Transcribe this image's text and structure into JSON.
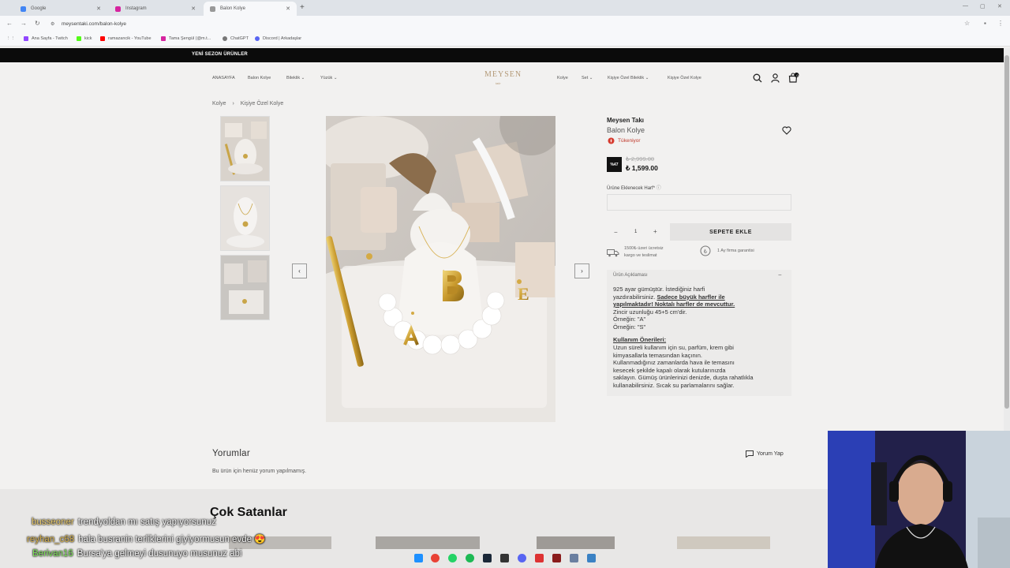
{
  "browser": {
    "tabs": [
      {
        "label": "Google",
        "active": false
      },
      {
        "label": "Instagram",
        "active": false
      },
      {
        "label": "Balon Kolye",
        "active": true
      }
    ],
    "url": "meysentaki.com/balon-kolye",
    "bookmarks": [
      "Ana Sayfa - Twitch",
      "kick",
      "ramazancik - YouTube",
      "Tama Şengül (@m.t...",
      "ChatGPT",
      "Discord | Arkadaşlar"
    ]
  },
  "announcement": "YENİ SEZON ÜRÜNLER",
  "header": {
    "nav_left": [
      "ANASAYFA",
      "Balon Kolye",
      "Bileklik",
      "Yüzük"
    ],
    "logo": "MEYSEN",
    "logo_sub": "takı",
    "nav_right": [
      "Kolye",
      "Set",
      "Kişiye Özel Bileklik",
      "Kişiye Özel Kolye"
    ],
    "cart_count": "0"
  },
  "breadcrumb": [
    "Kolye",
    "Kişiye Özel Kolye"
  ],
  "product": {
    "brand": "Meysen Takı",
    "name": "Balon Kolye",
    "trend": "Tükeniyor",
    "discount_badge": "%47",
    "old_price": "₺ 2,999.00",
    "price": "₺ 1,599.00",
    "letter_label": "Ürüne Eklenecek Harf*",
    "quantity": "1",
    "add_to_cart": "SEPETE EKLE",
    "feature_shipping_line1": "1500₺ üzeri ücretsiz",
    "feature_shipping_line2": "kargo ve teslimat",
    "feature_warranty": "1 Ay firma garantisi",
    "description_heading": "Ürün Açıklaması",
    "description": {
      "l1": "925 ayar gümüştür. İstediğiniz harfi",
      "l2a": "yazdırabilirsiniz. ",
      "l2b": "Sadece büyük harfler ile",
      "l3": "yapılmaktadır! Noktalı harfler de mevcuttur.",
      "l4": "Zincir uzunluğu 45+5 cm'dir.",
      "l5": "Örneğin: \"A\"",
      "l6": "Örneğin: \"S\"",
      "usage_title": "Kullanım Önerileri:",
      "u1": "Uzun süreli kullanım için su, parfüm, krem gibi",
      "u2": "kimyasallarla temasından kaçının.",
      "u3": "Kullanmadığınız zamanlarda hava ile temasını",
      "u4": "kesecek şekilde kapalı olarak kutularınızda",
      "u5": "saklayın. Gümüş ürünlerinizi denizde, duşta rahatlıkla",
      "u6": "kullanabilirsiniz. Sıcak su parlamalarını sağlar."
    }
  },
  "reviews": {
    "title": "Yorumlar",
    "empty": "Bu ürün için henüz yorum yapılmamış.",
    "write": "Yorum Yap"
  },
  "bestsellers_title": "Çok Satanlar",
  "chat": [
    {
      "user": "busseoner",
      "color": "#e8c96a",
      "text": "trendyoldan mı satış yapıyorsunuz"
    },
    {
      "user": "reyhan_c68",
      "color": "#d6b04a",
      "text": "hala busranin terliklerini giyiyormusun evde 😍"
    },
    {
      "user": "Berivan16",
      "color": "#7ee05a",
      "text": "Bursa'ya gelmeyi dusunuyo musunuz abi"
    }
  ],
  "colors": {
    "accent": "#b49a78",
    "trend_red": "#c0392b",
    "announcement_bg": "#0b0b0b"
  }
}
